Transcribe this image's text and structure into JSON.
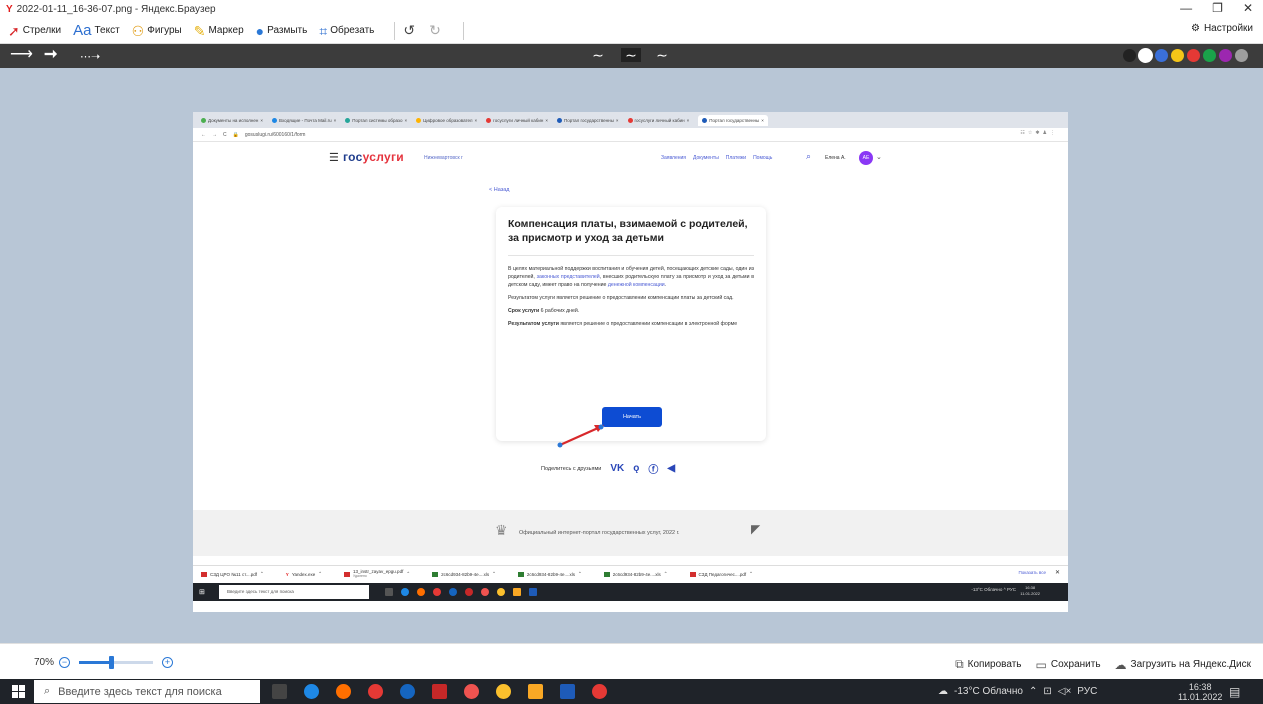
{
  "window": {
    "title": "2022-01-11_16-36-07.png - Яндекс.Браузер",
    "minimize": "—",
    "restore": "❐",
    "close": "✕"
  },
  "toolbar": {
    "arrows": "Стрелки",
    "text": "Текст",
    "shapes": "Фигуры",
    "marker": "Маркер",
    "blur": "Размыть",
    "crop": "Обрезать",
    "settings": "Настройки"
  },
  "palette": [
    "#222222",
    "#ffffff",
    "#3a6fd8",
    "#f5c518",
    "#e53935",
    "#1aa34a",
    "#9c27b0",
    "#9e9e9e"
  ],
  "shot": {
    "tabs": [
      "Документы на исполнен",
      "Входящие - Почта Mail.ru",
      "Портал системы образо",
      "Цифровое образовател",
      "госуслуги личный кабин",
      "Портал государственны",
      "госуслуги личный кабин",
      "Портал государственны"
    ],
    "url": "gosuslugi.ru/600160/1/form",
    "logo_a": "гос",
    "logo_b": "услуги",
    "city": "Нижневартовск г",
    "nav": [
      "Заявления",
      "Документы",
      "Платежи",
      "Помощь"
    ],
    "user": "Елена А.",
    "avatar": "АЕ",
    "back": "< Назад",
    "card": {
      "title": "Компенсация платы, взимаемой с родителей, за присмотр и уход за детьми",
      "p1_a": "В целях материальной поддержки воспитания и обучения детей, посещающих детские сады, один из родителей, ",
      "p1_link1": "законных представителей",
      "p1_b": ", внесших родительскую плату за присмотр и уход за детьми в детском саду, имеет право на получение ",
      "p1_link2": "денежной компенсации",
      "p1_c": ".",
      "p2": "Результатом услуги является решение о предоставлении компенсации платы за детский сад.",
      "p3_bold": "Срок услуги",
      "p3_rest": " 6 рабочих дней.",
      "p4_bold": "Результатом услуги",
      "p4_rest": " является решение о предоставлении компенсации в электронной форме",
      "button": "Начать"
    },
    "share": "Поделитесь с друзьями",
    "footer": "Официальный интернет-портал государственных услуг, 2022 г.",
    "downloads": [
      "СЗД ЦРО №11 ст....pdf",
      "Yandex.exe",
      "13_instr_zayav_epgu.pdf",
      "2c6cd934-82b9-4e....xls",
      "2c6cd934-82b9-4e....xls",
      "2c6cd934-82b9-4e....xls",
      "СЗД Педагогичес....pdf"
    ],
    "downloads_sub": "Удалено",
    "show_all": "Показать все",
    "taskbar_search": "Введите здесь текст для поиска",
    "tray": "-13°C Облачно  ^  РУС",
    "time": "16:38",
    "date": "11.01.2022"
  },
  "zoom": {
    "level": "70%",
    "fraction": 0.43
  },
  "actions": {
    "copy": "Копировать",
    "save": "Сохранить",
    "upload": "Загрузить на Яндекс.Диск"
  },
  "taskbar": {
    "search_placeholder": "Введите здесь текст для поиска",
    "weather": "-13°C Облачно",
    "lang": "РУС",
    "time": "16:38",
    "date": "11.01.2022"
  }
}
